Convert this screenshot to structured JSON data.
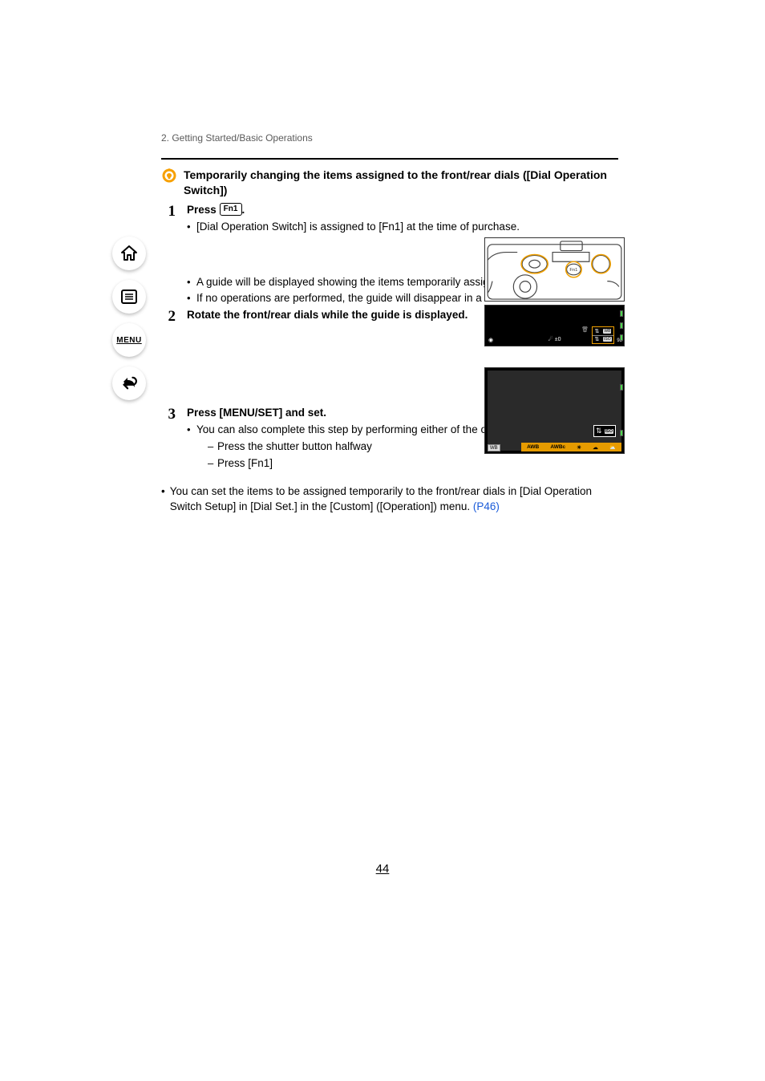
{
  "nav": {
    "home_label": "home-icon",
    "toc_label": "toc-icon",
    "menu_label": "MENU",
    "back_label": "back-icon"
  },
  "header": {
    "breadcrumb": "2. Getting Started/Basic Operations"
  },
  "tip": {
    "title": "Temporarily changing the items assigned to the front/rear dials ([Dial Operation Switch])"
  },
  "steps": {
    "s1": {
      "num": "1",
      "title_a": "Press ",
      "fn_label": "Fn1",
      "title_b": ".",
      "b1": "[Dial Operation Switch] is assigned to [Fn1] at the time of purchase.",
      "b2": "A guide will be displayed showing the items temporarily assigned to the front/rear dials.",
      "b3": "If no operations are performed, the guide will disappear in a few seconds."
    },
    "s2": {
      "num": "2",
      "title": "Rotate the front/rear dials while the guide is displayed."
    },
    "s3": {
      "num": "3",
      "title": "Press [MENU/SET] and set.",
      "b1": "You can also complete this step by performing either of the operations below:",
      "d1": "Press the shutter button halfway",
      "d2": "Press [Fn1]"
    }
  },
  "note": {
    "text_a": "You can set the items to be assigned temporarily to the front/rear dials in [Dial Operation Switch Setup] in [Dial Set.] in the [Custom] ([Operation]) menu. ",
    "link": "(P46)"
  },
  "illus": {
    "fn1": "Fn1",
    "ev": "±0",
    "wb": "WB",
    "iso": "ISO",
    "awb": "AWB",
    "awbc": "AWBc",
    "rec_count": "98"
  },
  "page_number": "44"
}
